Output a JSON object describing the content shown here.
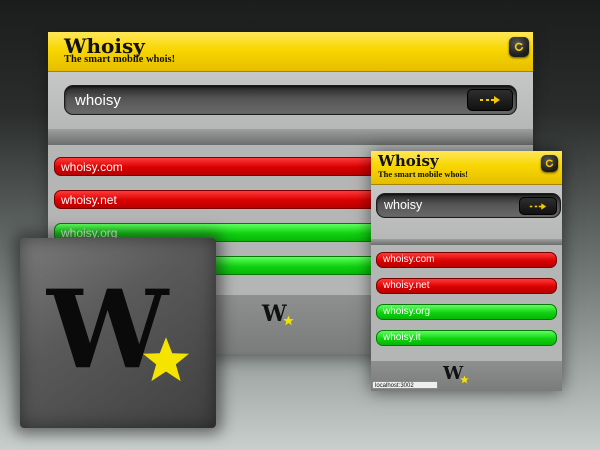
{
  "app": {
    "title": "Whoisy",
    "subtitle": "The smart mobile whois!"
  },
  "icons": {
    "refresh": "refresh-icon",
    "go": "arrow-right-icon",
    "logo": "whoisy-w-star-logo"
  },
  "large_view": {
    "search_value": "whoisy",
    "go_label": "┇➜",
    "results": [
      {
        "domain": "whoisy.com",
        "status": "taken"
      },
      {
        "domain": "whoisy.net",
        "status": "taken"
      },
      {
        "domain": "whoisy.org",
        "status": "available"
      },
      {
        "domain": "",
        "status": "available"
      }
    ]
  },
  "small_view": {
    "search_value": "whoisy",
    "go_label": "┇➜",
    "results": [
      {
        "domain": "whoisy.com",
        "status": "taken"
      },
      {
        "domain": "whoisy.net",
        "status": "taken"
      },
      {
        "domain": "whoisy.org",
        "status": "available"
      },
      {
        "domain": "whoisy.it",
        "status": "available"
      }
    ],
    "status_url": "localhost:3002"
  },
  "logo": {
    "letter": "W"
  },
  "colors": {
    "header_yellow": "#f8d600",
    "taken_red": "#d90000",
    "available_green": "#10d210",
    "star_yellow": "#f5e400"
  }
}
